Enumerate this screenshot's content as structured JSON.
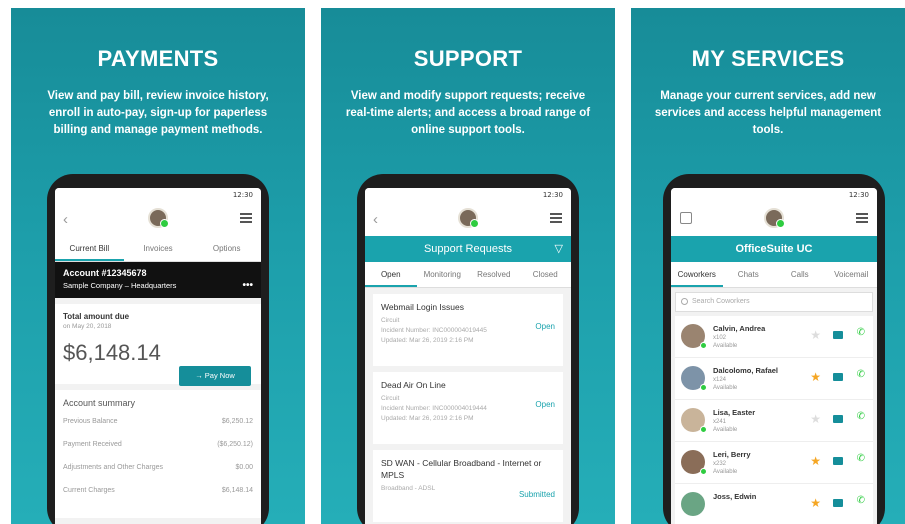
{
  "panels": [
    {
      "title": "PAYMENTS",
      "description": "View and pay bill, review invoice history, enroll in auto-pay, sign-up for paperless billing and manage payment methods.",
      "status_time": "12:30",
      "tabs": [
        "Current Bill",
        "Invoices",
        "Options"
      ],
      "account_number": "Account #12345678",
      "account_company": "Sample Company – Headquarters",
      "total_due_label": "Total amount due",
      "due_date": "on May 20, 2018",
      "amount": "$6,148.14",
      "pay_button": "→ Pay Now",
      "summary_title": "Account summary",
      "summary_rows": [
        {
          "label": "Previous Balance",
          "value": "$6,250.12"
        },
        {
          "label": "Payment Received",
          "value": "($6,250.12)"
        },
        {
          "label": "Adjustments and Other Charges",
          "value": "$0.00"
        },
        {
          "label": "Current Charges",
          "value": "$6,148.14"
        }
      ]
    },
    {
      "title": "SUPPORT",
      "description": "View and modify support requests; receive real-time alerts; and access a broad range of online support tools.",
      "status_time": "12:30",
      "header": "Support Requests",
      "tabs": [
        "Open",
        "Monitoring",
        "Resolved",
        "Closed"
      ],
      "requests": [
        {
          "title": "Webmail Login Issues",
          "type": "Circuit",
          "incident": "Incident Number: INC000004019445",
          "updated": "Updated: Mar 26, 2019 2:16 PM",
          "status": "Open"
        },
        {
          "title": "Dead Air On Line",
          "type": "Circuit",
          "incident": "Incident Number: INC000004019444",
          "updated": "Updated: Mar 26, 2019 2:16 PM",
          "status": "Open"
        },
        {
          "title": "SD WAN - Cellular Broadband - Internet or MPLS",
          "type": "Broadband - ADSL",
          "incident": "",
          "updated": "",
          "status": "Submitted"
        }
      ]
    },
    {
      "title": "MY SERVICES",
      "description": "Manage your current services, add new services and access helpful management tools.",
      "status_time": "12:30",
      "header": "OfficeSuite UC",
      "tabs": [
        "Coworkers",
        "Chats",
        "Calls",
        "Voicemail"
      ],
      "search_placeholder": "Search Coworkers",
      "contacts": [
        {
          "name": "Calvin, Andrea",
          "ext": "x102",
          "status": "Available",
          "favorite": false
        },
        {
          "name": "Dalcolomo, Rafael",
          "ext": "x124",
          "status": "Available",
          "favorite": true
        },
        {
          "name": "Lisa, Easter",
          "ext": "x241",
          "status": "Available",
          "favorite": false
        },
        {
          "name": "Leri, Berry",
          "ext": "x232",
          "status": "Available",
          "favorite": true
        },
        {
          "name": "Joss, Edwin",
          "ext": "",
          "status": "",
          "favorite": true
        }
      ]
    }
  ],
  "colors": {
    "teal": "#1aa3ad",
    "panel_bg": "#1d9eaa",
    "green": "#2ecc40",
    "star": "#f5a623"
  }
}
